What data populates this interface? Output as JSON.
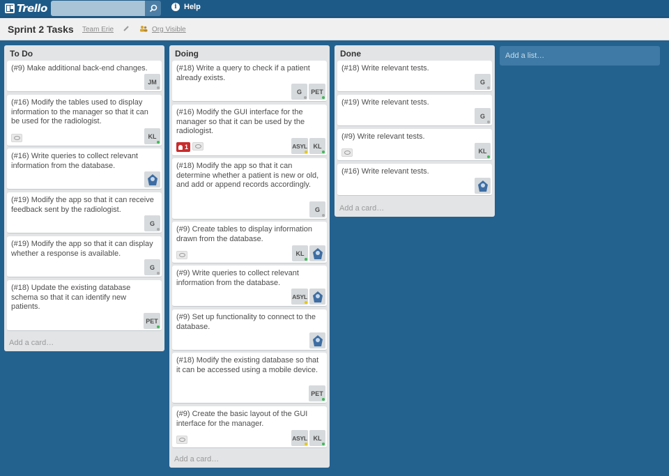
{
  "header": {
    "logo": "Trello",
    "search": {
      "value": "",
      "placeholder": ""
    },
    "help": "Help"
  },
  "board": {
    "title": "Sprint 2 Tasks",
    "team": "Team Erie",
    "visibility": "Org Visible"
  },
  "add_list": "Add a list…",
  "add_card": "Add a card…",
  "lists": [
    {
      "title": "To Do",
      "cards": [
        {
          "text": "(#9) Make additional back-end changes.",
          "members": [
            "JM"
          ]
        },
        {
          "text": "(#16) Modify the tables used to display information to the manager so that it can be used for the radiologist.",
          "watch": true,
          "members": [
            "KL"
          ]
        },
        {
          "text": "(#16) Write queries to collect relevant information from the database.",
          "members": [
            "avatar"
          ]
        },
        {
          "text": "(#19) Modify the app so that it can receive feedback sent by the radiologist.",
          "members": [
            "G"
          ]
        },
        {
          "text": "(#19) Modify the app so that it can display whether a response is available.",
          "members": [
            "G"
          ]
        },
        {
          "text": "(#18) Update the existing database schema so that it can identify new patients.",
          "members": [
            "PET"
          ]
        }
      ]
    },
    {
      "title": "Doing",
      "cards": [
        {
          "text": "(#18) Write a query to check if a patient already exists.",
          "members": [
            "G",
            "PET"
          ]
        },
        {
          "text": "(#16) Modify the GUI interface for the manager so that it can be used by the radiologist.",
          "due": "1",
          "watch": true,
          "members": [
            "ASYL",
            "KL"
          ]
        },
        {
          "text": "(#18) Modify the app so that it can determine whether a patient is new or old, and add or append records accordingly.",
          "members": [
            "G"
          ]
        },
        {
          "text": "(#9) Create tables to display information drawn from the database.",
          "watch": true,
          "members": [
            "KL",
            "avatar"
          ]
        },
        {
          "text": "(#9) Write queries to collect relevant information from the database.",
          "members": [
            "ASYL",
            "avatar"
          ]
        },
        {
          "text": "(#9) Set up functionality to connect to the database.",
          "members": [
            "avatar"
          ]
        },
        {
          "text": "(#18) Modify the existing database so that it can be accessed using a mobile device.",
          "members": [
            "PET"
          ]
        },
        {
          "text": "(#9) Create the basic layout of the GUI interface for the manager.",
          "watch": true,
          "members": [
            "ASYL",
            "KL"
          ]
        }
      ]
    },
    {
      "title": "Done",
      "cards": [
        {
          "text": "(#18) Write relevant tests.",
          "members": [
            "G"
          ]
        },
        {
          "text": "(#19) Write relevant tests.",
          "members": [
            "G"
          ]
        },
        {
          "text": "(#9) Write relevant tests.",
          "watch": true,
          "members": [
            "KL"
          ]
        },
        {
          "text": "(#16) Write relevant tests.",
          "members": [
            "avatar"
          ]
        }
      ]
    }
  ],
  "colors": {
    "background": "#23618f",
    "header": "#1e5a87",
    "list": "#e2e4e6",
    "due_badge": "#c92c2c",
    "online": "#3cba54",
    "idle": "#e6c60d"
  },
  "icons": {
    "search": "search-icon",
    "help": "info-icon",
    "edit": "pencil-icon",
    "org": "org-people-icon",
    "watch": "eye-icon",
    "due": "alarm-icon",
    "avatar": "avatar-image"
  }
}
